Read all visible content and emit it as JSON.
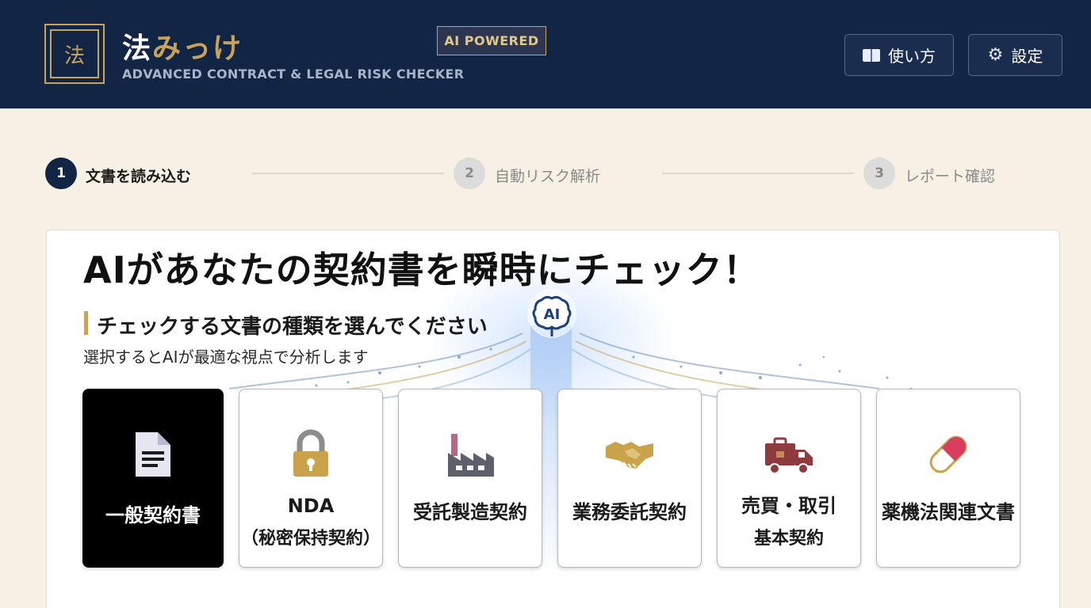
{
  "header": {
    "logo_char": "法",
    "title_main": "法",
    "title_accent": "みっけ",
    "subtitle": "ADVANCED CONTRACT & LEGAL RISK CHECKER",
    "badge": "AI POWERED",
    "help_label": "使い方",
    "settings_label": "設定"
  },
  "stepper": {
    "steps": [
      {
        "num": "1",
        "label": "文書を読み込む",
        "active": true
      },
      {
        "num": "2",
        "label": "自動リスク解析",
        "active": false
      },
      {
        "num": "3",
        "label": "レポート確認",
        "active": false
      }
    ]
  },
  "main": {
    "headline": "AIがあなたの契約書を瞬時にチェック！",
    "section_title": "チェックする文書の種類を選んでください",
    "section_subtitle": "選択するとAIが最適な視点で分析します",
    "center_icon": "ai-brain-icon",
    "options": [
      {
        "label": "一般契約書",
        "label2": "",
        "icon": "document-icon",
        "selected": true
      },
      {
        "label": "NDA",
        "label2": "（秘密保持契約）",
        "icon": "lock-icon",
        "selected": false
      },
      {
        "label": "受託製造契約",
        "label2": "",
        "icon": "factory-icon",
        "selected": false
      },
      {
        "label": "業務委託契約",
        "label2": "",
        "icon": "handshake-icon",
        "selected": false
      },
      {
        "label": "売買・取引",
        "label2": "基本契約",
        "icon": "truck-icon",
        "selected": false
      },
      {
        "label": "薬機法関連文書",
        "label2": "",
        "icon": "pill-icon",
        "selected": false
      }
    ]
  },
  "colors": {
    "navy": "#132545",
    "gold": "#c8a45a",
    "background": "#f6f1e4"
  }
}
